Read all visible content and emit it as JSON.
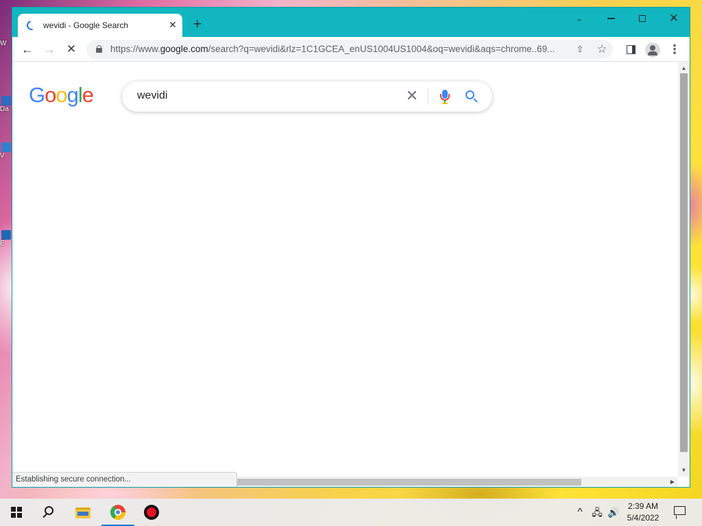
{
  "desktop": {
    "icons": [
      {
        "label": "W"
      },
      {
        "label": "Da"
      },
      {
        "label": "V"
      },
      {
        "label": "E"
      }
    ]
  },
  "browser": {
    "tab": {
      "title": "wevidi - Google Search",
      "close": "✕"
    },
    "new_tab": "+",
    "window_controls": {
      "tab_search": "⌄",
      "close": "✕"
    },
    "nav": {
      "back": "←",
      "forward": "→",
      "stop": "✕"
    },
    "url": {
      "prefix": "https://www.",
      "host": "google.com",
      "path": "/search?q=wevidi&rlz=1C1GCEA_enUS1004US1004&oq=wevidi&aqs=chrome..69..."
    },
    "actions": {
      "share": "⇪",
      "bookmark": "☆",
      "menu": "⋮"
    },
    "status": "Establishing secure connection..."
  },
  "page": {
    "logo": {
      "l1": "G",
      "l2": "o",
      "l3": "o",
      "l4": "g",
      "l5": "l",
      "l6": "e"
    },
    "search": {
      "query": "wevidi",
      "clear": "✕"
    }
  },
  "scrollbars": {
    "up": "▲",
    "down": "▼",
    "right": "▶"
  },
  "taskbar": {
    "tray": {
      "chevron": "^",
      "network": "🖧",
      "volume": "🔊"
    },
    "clock": {
      "time": "2:39 AM",
      "date": "5/4/2022"
    }
  }
}
